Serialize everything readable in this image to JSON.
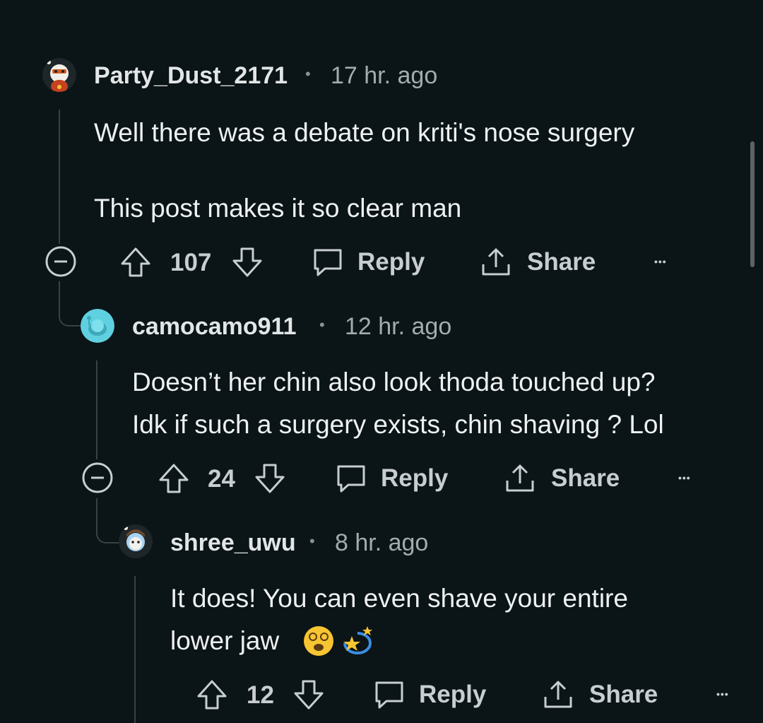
{
  "comments": [
    {
      "username": "Party_Dust_2171",
      "separator": "•",
      "time": "17 hr. ago",
      "lines": [
        "Well there was a debate on kriti's nose surgery",
        "This post makes it so clear man"
      ],
      "votes": "107",
      "reply_label": "Reply",
      "share_label": "Share",
      "more": "•••"
    },
    {
      "username": "camocamo911",
      "separator": "•",
      "time": "12 hr. ago",
      "lines": [
        "Doesn’t her chin also look thoda touched up?",
        "Idk if such a surgery exists, chin shaving ? Lol"
      ],
      "votes": "24",
      "reply_label": "Reply",
      "share_label": "Share",
      "more": "•••"
    },
    {
      "username": "shree_uwu",
      "separator": "•",
      "time": "8 hr. ago",
      "lines": [
        "It does! You can even shave your entire",
        "lower jaw"
      ],
      "emojis": [
        "dizzy-face-emoji",
        "dizzy-star-emoji"
      ],
      "votes": "12",
      "reply_label": "Reply",
      "share_label": "Share",
      "more": "•••"
    }
  ],
  "icons": {
    "collapse": "minus-circle-icon",
    "upvote": "arrow-up-icon",
    "downvote": "arrow-down-icon",
    "reply": "speech-bubble-icon",
    "share": "share-upload-icon",
    "more": "more-dots-icon"
  },
  "colors": {
    "background": "#0b1416",
    "text": "#eef1f2",
    "muted": "#a3abae"
  }
}
